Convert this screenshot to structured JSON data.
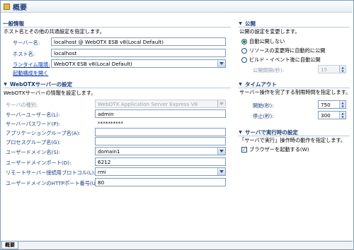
{
  "header": {
    "title": "概要"
  },
  "general": {
    "heading": "一般情報",
    "description": "ホスト名とその他の共通設定を指定します。",
    "server_name_label": "サーバー名:",
    "server_name_value": "localhost @ WebOTX ESB v8(Local Default)",
    "host_name_label": "ホスト名:",
    "host_name_value": "localhost",
    "runtime_label": "ランタイム環境:",
    "runtime_value": "WebOTX ESB v8(Local Default)",
    "launch_config_link": "起動構成を開く"
  },
  "webotx": {
    "heading": "WebOTXサーバーの設定",
    "description": "WebOTXサーバーの情報を設定します。",
    "server_type_label": "サーバの種別:",
    "server_type_value": "WebOTX Application Server Express V8",
    "user_name_label": "サーバーユーザー名(L):",
    "user_name_value": "admin",
    "password_label": "サーバーパスワード(P):",
    "password_value": "**********",
    "app_group_label": "アプリケーショングループ名(A):",
    "app_group_value": "",
    "process_group_label": "プロセスグループ名(G):",
    "process_group_value": "",
    "user_domain_label": "ユーザードメイン名(S):",
    "user_domain_value": "domain1",
    "domain_port_label": "ユーザードメインポート(D):",
    "domain_port_value": "6212",
    "remote_protocol_label": "リモートサーバー接続用プロトコル(L):",
    "remote_protocol_value": "rmi",
    "http_port_label": "ユーザードメインのHTTPポート番号(U):",
    "http_port_value": "80"
  },
  "publish": {
    "heading": "公開",
    "description": "公開の設定を変更します。",
    "opt_none": "自動公開しない",
    "opt_on_change": "リソースの変更時に自動的に公開",
    "opt_on_build": "ビルド・イベント後に自動公開",
    "interval_label": "公開間隔(秒):",
    "interval_value": "15",
    "selected": "none"
  },
  "timeout": {
    "heading": "タイムアウト",
    "description": "サーバー操作を完了する制限時間を指定します。",
    "start_label": "開始(秒):",
    "start_value": "750",
    "stop_label": "停止(秒):",
    "stop_value": "300"
  },
  "run_settings": {
    "heading": "サーバで実行時の設定",
    "description": "「サーバで実行」操作時の動作を指定します。",
    "open_browser_label": "ブラウザーを起動する(W)",
    "open_browser_checked": true
  },
  "footer": {
    "tab_overview": "概要"
  },
  "colors": {
    "heading": "#1c3d77",
    "label": "#1b3f7c",
    "border": "#7f9db9"
  }
}
